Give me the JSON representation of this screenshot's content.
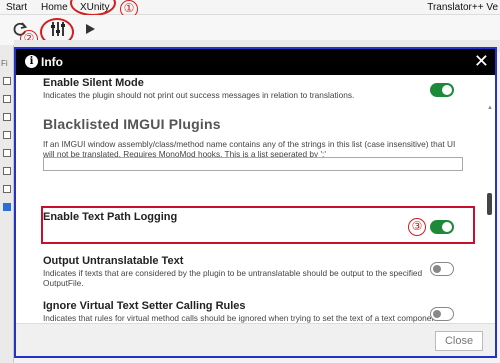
{
  "menu": {
    "items": [
      "Start",
      "Home",
      "XUnity"
    ],
    "app_title": "Translator++ Ve"
  },
  "left_tab_fragment": "Fi",
  "annotations": {
    "one": "①",
    "two": "②",
    "three": "③"
  },
  "dialog": {
    "title": "Info",
    "close_glyph": "✕",
    "section_title": "Blacklisted IMGUI Plugins",
    "section_desc": "If an IMGUI window assembly/class/method name contains any of the strings in this list (case insensitive) that UI will not be translated. Requires MonoMod hooks. This is a list seperated by ';'",
    "settings": [
      {
        "title": "Enable Silent Mode",
        "desc": "Indicates the plugin should not print out success messages in relation to translations.",
        "enabled": true
      },
      {
        "title": "Enable Text Path Logging",
        "desc": "",
        "enabled": true
      },
      {
        "title": "Output Untranslatable Text",
        "desc": "Indicates if texts that are considered by the plugin to be untranslatable should be output to the specified OutputFile.",
        "enabled": false
      },
      {
        "title": "Ignore Virtual Text Setter Calling Rules",
        "desc": "Indicates that rules for virtual method calls should be ignored when trying to set the text of a text component. May in some cases help setting the text of stubborn components.",
        "enabled": false
      }
    ],
    "close_button": "Close"
  },
  "colors": {
    "toggle_on": "#1c8a3a",
    "highlight": "#c8102e",
    "dialog_border": "#2233cc"
  }
}
